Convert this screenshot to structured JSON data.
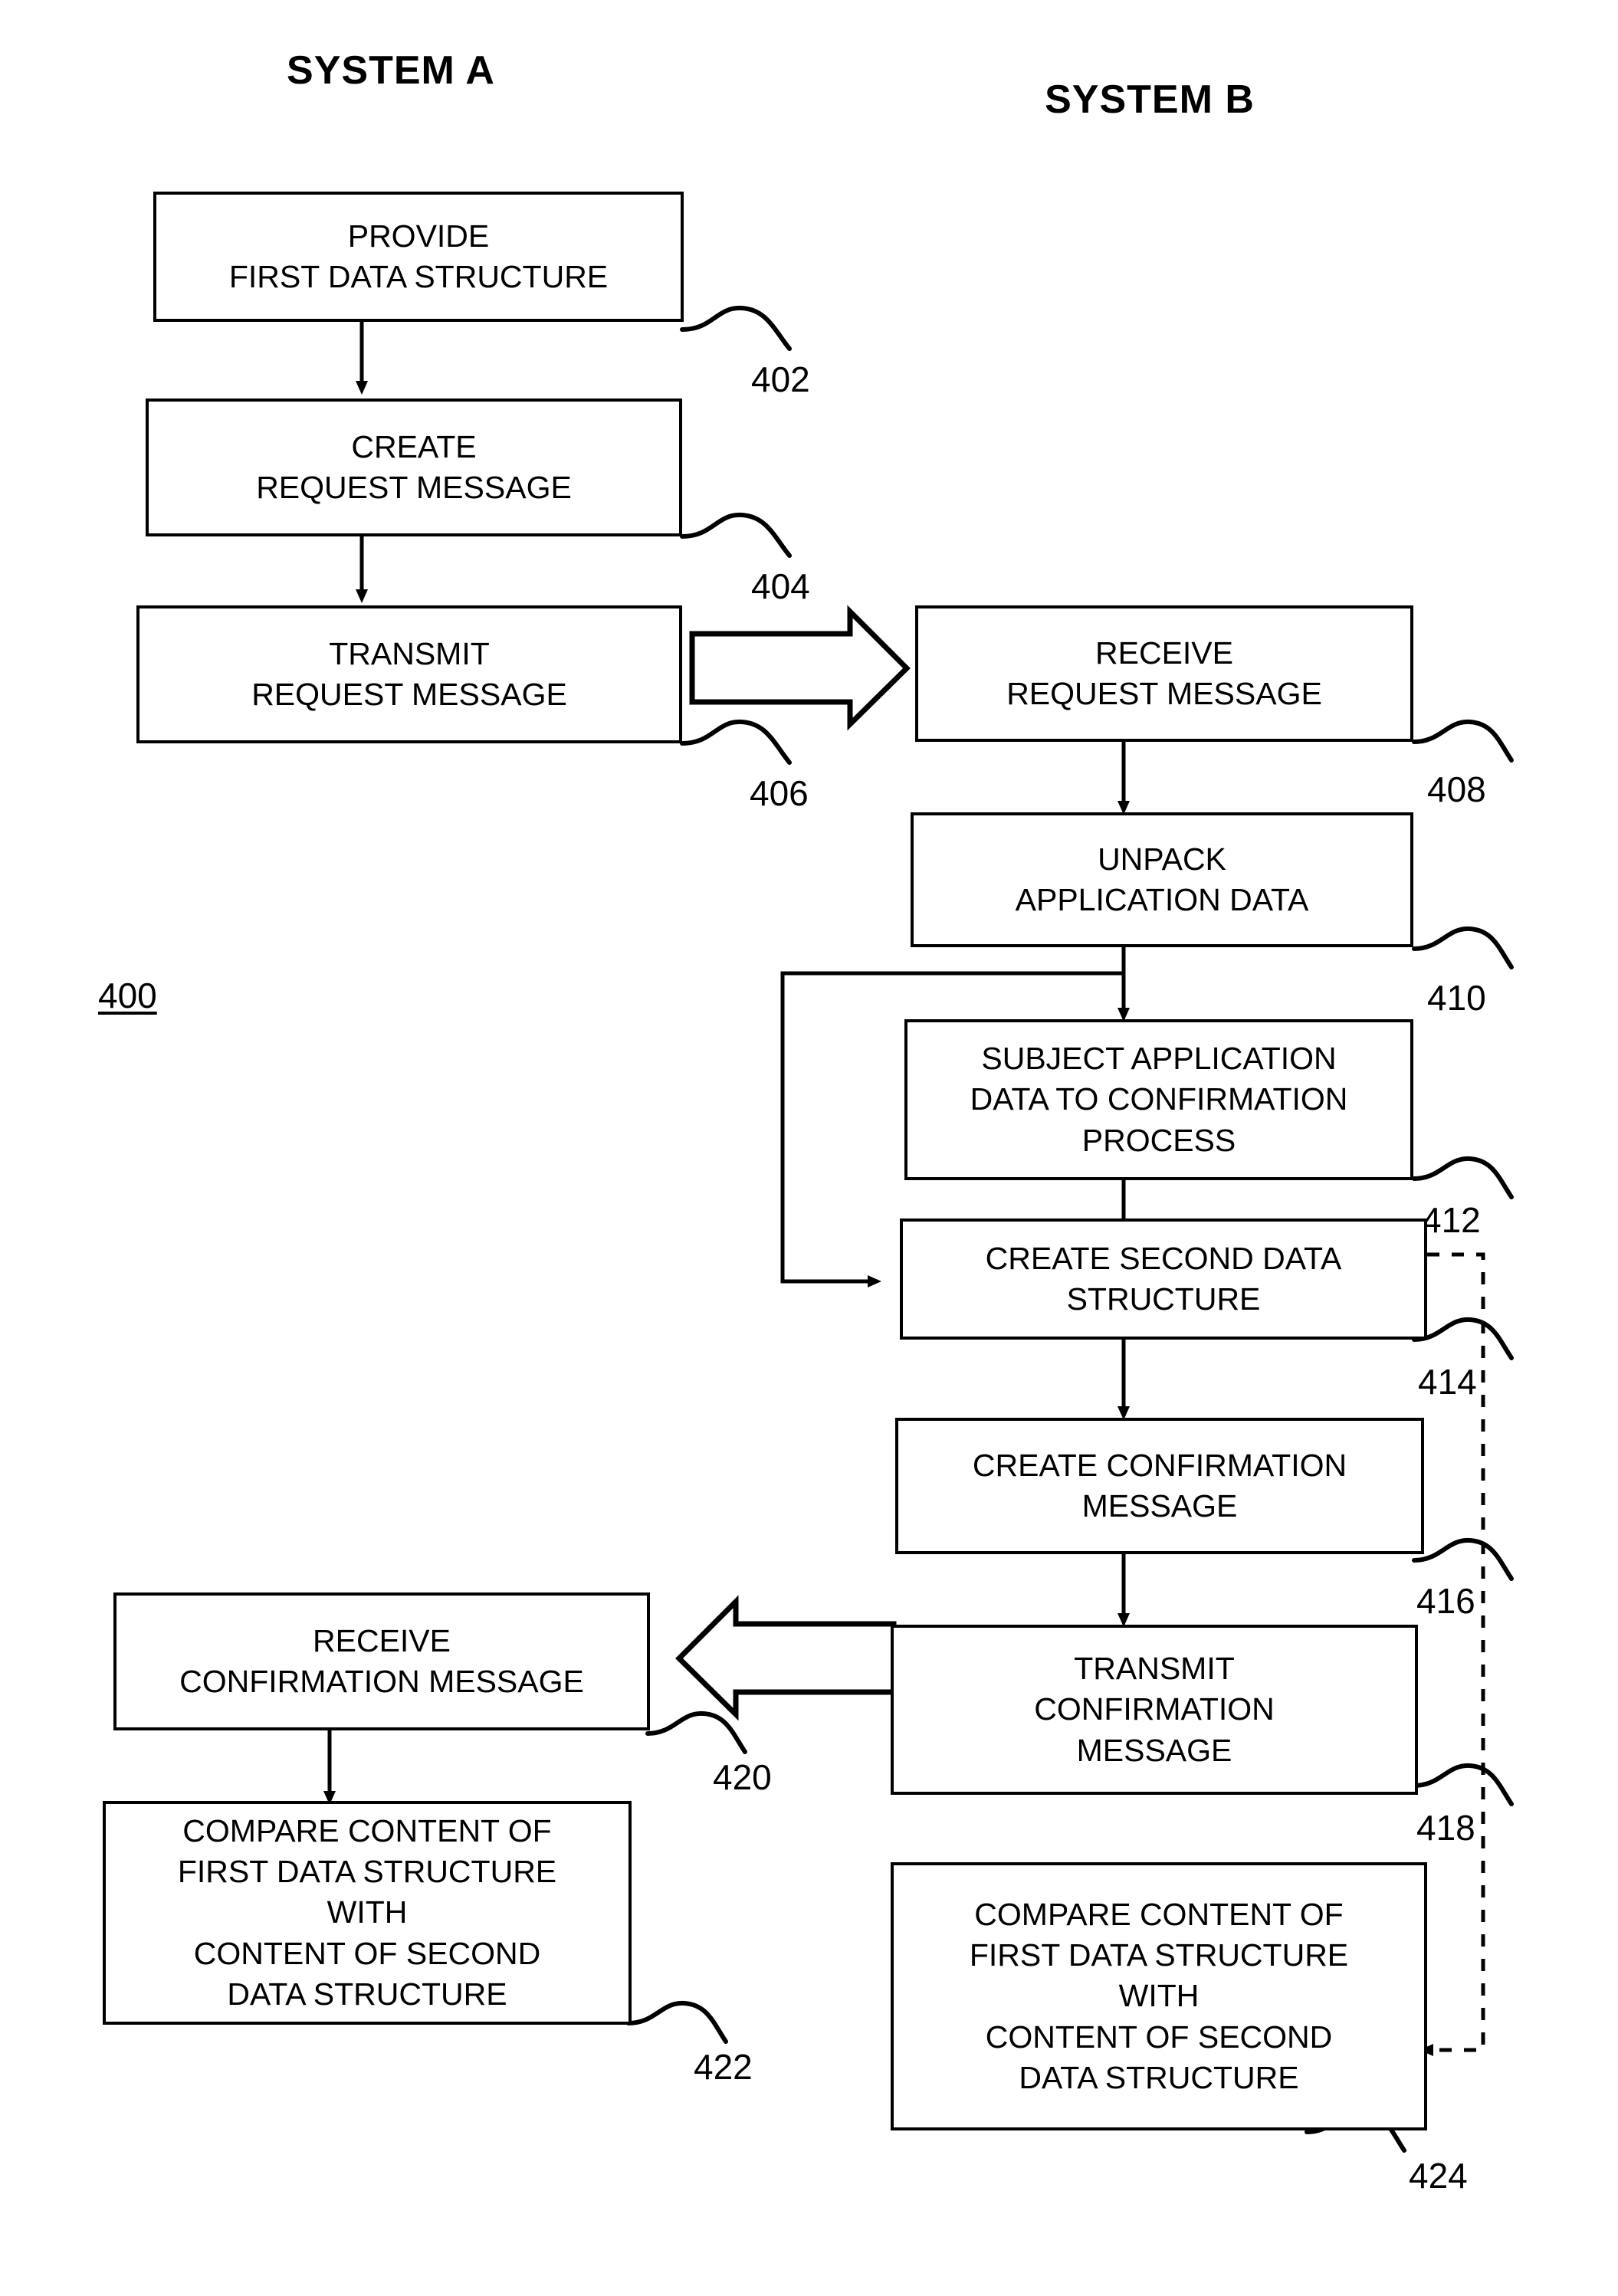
{
  "figure": {
    "number": "400",
    "columns": [
      {
        "id": "system-a",
        "label": "SYSTEM A"
      },
      {
        "id": "system-b",
        "label": "SYSTEM B"
      }
    ]
  },
  "boxes": [
    {
      "id": "provide-first-data-structure",
      "ref": "402",
      "column": "system-a",
      "lines": [
        "PROVIDE",
        "FIRST DATA STRUCTURE"
      ]
    },
    {
      "id": "create-request-message",
      "ref": "404",
      "column": "system-a",
      "lines": [
        "CREATE",
        "REQUEST MESSAGE"
      ]
    },
    {
      "id": "transmit-request-message",
      "ref": "406",
      "column": "system-a",
      "lines": [
        "TRANSMIT",
        "REQUEST MESSAGE"
      ]
    },
    {
      "id": "receive-request-message",
      "ref": "408",
      "column": "system-b",
      "lines": [
        "RECEIVE",
        "REQUEST MESSAGE"
      ]
    },
    {
      "id": "unpack-application-data",
      "ref": "410",
      "column": "system-b",
      "lines": [
        "UNPACK",
        "APPLICATION DATA"
      ]
    },
    {
      "id": "subject-application-data-to-confirmation-process",
      "ref": "412",
      "column": "system-b",
      "lines": [
        "SUBJECT APPLICATION",
        "DATA TO CONFIRMATION",
        "PROCESS"
      ]
    },
    {
      "id": "create-second-data-structure",
      "ref": "414",
      "column": "system-b",
      "lines": [
        "CREATE SECOND DATA",
        "STRUCTURE"
      ]
    },
    {
      "id": "create-confirmation-message",
      "ref": "416",
      "column": "system-b",
      "lines": [
        "CREATE CONFIRMATION",
        "MESSAGE"
      ]
    },
    {
      "id": "transmit-confirmation-message",
      "ref": "418",
      "column": "system-b",
      "lines": [
        "TRANSMIT",
        "CONFIRMATION",
        "MESSAGE"
      ]
    },
    {
      "id": "receive-confirmation-message",
      "ref": "420",
      "column": "system-a",
      "lines": [
        "RECEIVE",
        "CONFIRMATION MESSAGE"
      ]
    },
    {
      "id": "compare-content-system-a",
      "ref": "422",
      "column": "system-a",
      "lines": [
        "COMPARE CONTENT OF",
        "FIRST DATA STRUCTURE",
        "WITH",
        "CONTENT OF SECOND",
        "DATA STRUCTURE"
      ]
    },
    {
      "id": "compare-content-system-b",
      "ref": "424",
      "column": "system-b",
      "lines": [
        "COMPARE CONTENT OF",
        "FIRST DATA STRUCTURE",
        "WITH",
        "CONTENT OF SECOND",
        "DATA STRUCTURE"
      ]
    }
  ],
  "colors": {
    "ink": "#000000",
    "paper": "#ffffff"
  }
}
